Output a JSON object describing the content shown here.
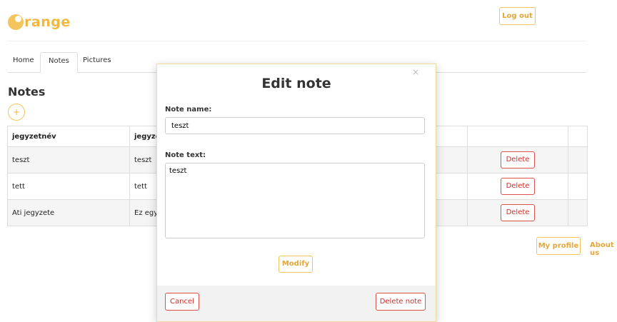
{
  "header": {
    "logo_text": "range",
    "logout_label": "Log out"
  },
  "tabs": [
    {
      "label": "Home"
    },
    {
      "label": "Notes"
    },
    {
      "label": "Pictures"
    }
  ],
  "page": {
    "title": "Notes",
    "add_label": "+"
  },
  "table": {
    "headers": [
      "jegyzetnév",
      "jegyzet",
      "",
      ""
    ],
    "rows": [
      {
        "name": "teszt",
        "text": "teszt",
        "delete_label": "Delete"
      },
      {
        "name": "tett",
        "text": "tett",
        "delete_label": "Delete"
      },
      {
        "name": "Ati jegyzete",
        "text": "Ez egy j",
        "delete_label": "Delete"
      }
    ]
  },
  "footer_links": {
    "my_profile": "My profile",
    "about_us": "About us"
  },
  "modal": {
    "title": "Edit note",
    "close_icon": "×",
    "name_label": "Note name:",
    "name_value": "teszt",
    "text_label": "Note text:",
    "text_value": "teszt",
    "modify_label": "Modify",
    "cancel_label": "Cancel",
    "delete_label": "Delete note"
  }
}
